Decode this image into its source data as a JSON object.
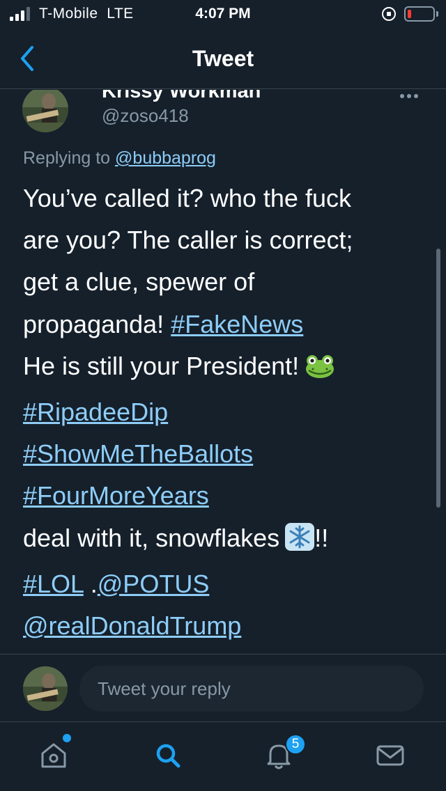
{
  "status_bar": {
    "carrier": "T-Mobile",
    "network": "LTE",
    "time": "4:07 PM",
    "battery_level_percent": 5
  },
  "header": {
    "title": "Tweet",
    "back_icon": "chevron-left-icon"
  },
  "tweet": {
    "display_name": "Krissy Workman",
    "handle": "@zoso418",
    "replying_prefix": "Replying to",
    "replying_to": "@bubbaprog",
    "text_lines": {
      "l1": "You’ve called it? who the fuck",
      "l2": "are you? The caller is correct;",
      "l3": "get a clue, spewer of",
      "l4_text": "propaganda!",
      "l4_link": "#FakeNews",
      "l5_text": "He is still your President!",
      "l6_link": "#RipadeeDip",
      "l7_link": "#ShowMeTheBallots",
      "l8_link": "#FourMoreYears",
      "l9_text": "deal with it, snowflakes",
      "l9_suffix": "!!",
      "l10_link_a": "#LOL",
      "l10_sep": ".",
      "l10_link_b": "@POTUS",
      "l11_link": "@realDonaldTrump"
    },
    "emojis": [
      "frog-emoji",
      "snowflake-emoji"
    ]
  },
  "reply": {
    "placeholder": "Tweet your reply"
  },
  "tab_bar": {
    "tabs": [
      "home-icon",
      "search-icon",
      "notifications-icon",
      "messages-icon"
    ],
    "notifications_badge": "5"
  },
  "colors": {
    "background": "#15202b",
    "link": "#8ecdf8",
    "accent": "#1da1f2",
    "secondary_text": "#8899a6"
  }
}
